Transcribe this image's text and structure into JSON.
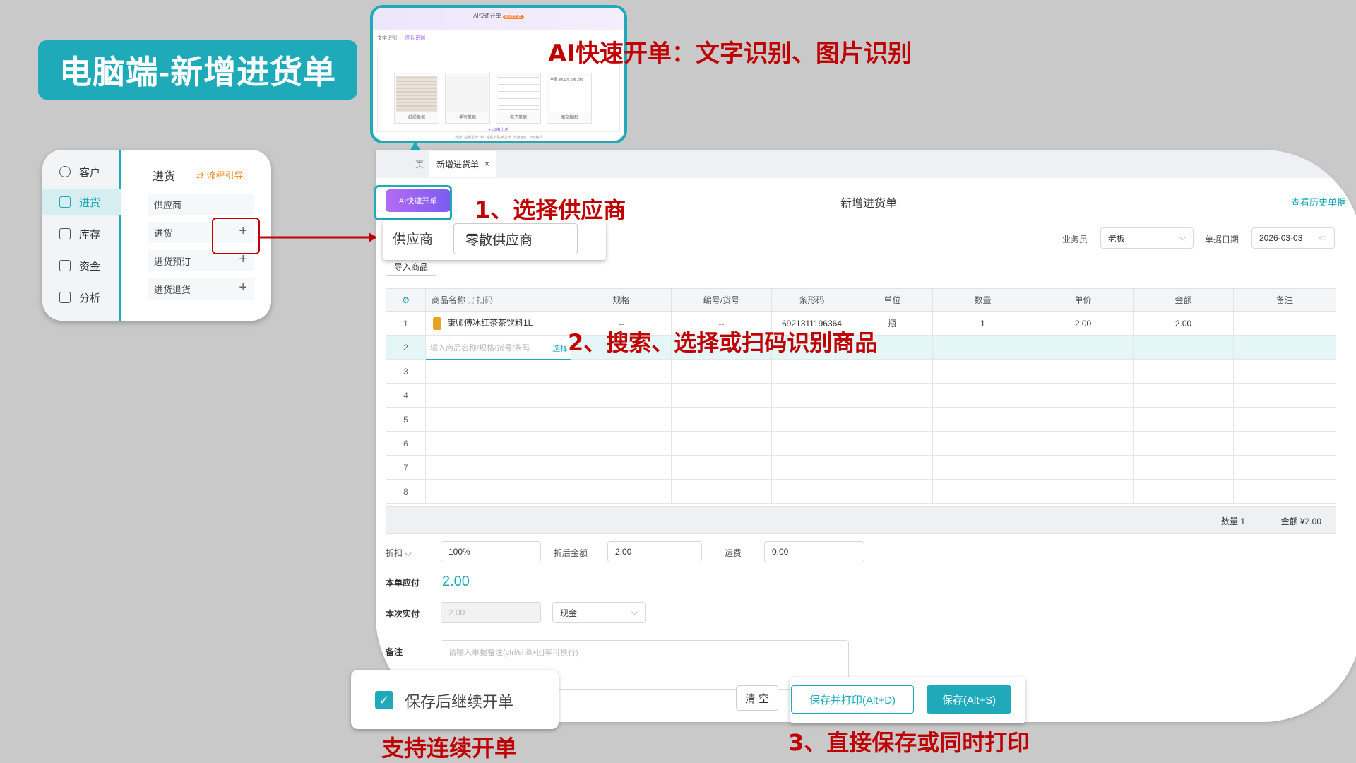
{
  "banner": {
    "title": "电脑端-新增进货单"
  },
  "annotations": {
    "ai": "AI快速开单：文字识别、图片识别",
    "step1": "1、选择供应商",
    "step2": "2、搜索、选择或扫码识别商品",
    "step3": "3、直接保存或同时打印",
    "continuous": "支持连续开单"
  },
  "side_menu": {
    "items": [
      {
        "label": "客户",
        "icon": "user-icon"
      },
      {
        "label": "进货",
        "icon": "purchase-icon"
      },
      {
        "label": "库存",
        "icon": "home-icon"
      },
      {
        "label": "资金",
        "icon": "wallet-icon"
      },
      {
        "label": "分析",
        "icon": "chart-icon"
      }
    ],
    "section_title": "进货",
    "flow_guide": "流程引导",
    "sub_items": [
      "供应商",
      "进货",
      "进货预订",
      "进货退货"
    ],
    "plus": "+"
  },
  "ai_popup": {
    "title": "AI快速开单",
    "badge": "限时免费",
    "tabs": [
      "文字识别",
      "图片识别"
    ],
    "samples": [
      "纸质单据",
      "手写单据",
      "电子单据",
      "图文截图"
    ],
    "upload": "+ 点击上传",
    "sample_text": "苹果 3000元 5箱 2箱",
    "footer": "支持 \"拍摄上传\" 和 \"粘贴剪贴板上传\" 支持 jpg、png格式"
  },
  "window": {
    "tab_prev": "页",
    "tab_label": "新增进货单",
    "tab_close": "×",
    "title": "新增进货单",
    "history_link": "查看历史单据",
    "ai_button": "AI快速开单"
  },
  "supplier": {
    "label": "供应商",
    "value": "零散供应商"
  },
  "header_fields": {
    "salesman_label": "业务员",
    "salesman_value": "老板",
    "date_label": "单据日期",
    "date_value": "2026-03-03"
  },
  "import_button": "导入商品",
  "table": {
    "columns": [
      "商品名称",
      "规格",
      "编号/货号",
      "条形码",
      "单位",
      "数量",
      "单价",
      "金额",
      "备注"
    ],
    "scan_label": "扫码",
    "rows": [
      {
        "idx": "1",
        "name": "康师傅冰红茶茶饮料1L",
        "spec": "--",
        "code": "--",
        "barcode": "6921311196364",
        "unit": "瓶",
        "qty": "1",
        "price": "2.00",
        "amount": "2.00",
        "note": ""
      },
      {
        "idx": "2"
      },
      {
        "idx": "3"
      },
      {
        "idx": "4"
      },
      {
        "idx": "5"
      },
      {
        "idx": "6"
      },
      {
        "idx": "7"
      },
      {
        "idx": "8"
      }
    ],
    "search_placeholder": "输入商品名称/规格/货号/条码",
    "search_pick": "选择",
    "summary_qty": "数量 1",
    "summary_amount": "金额 ¥2.00"
  },
  "footer_fields": {
    "discount_label": "折扣",
    "discount_value": "100%",
    "after_discount_label": "折后金额",
    "after_discount_value": "2.00",
    "freight_label": "运费",
    "freight_value": "0.00",
    "payable_label": "本单应付",
    "payable_value": "2.00",
    "paid_label": "本次实付",
    "paid_value": "2.00",
    "pay_method": "现金",
    "remark_label": "备注",
    "remark_placeholder": "请输入单据备注(ctrl/shift+回车可换行)"
  },
  "buttons": {
    "continue": "保存后继续开单",
    "clear": "清 空",
    "save_print": "保存并打印(Alt+D)",
    "save": "保存(Alt+S)"
  },
  "colors": {
    "accent": "#1eaab9",
    "annotation": "#c00000",
    "ai_gradient": "#9b5de5"
  }
}
